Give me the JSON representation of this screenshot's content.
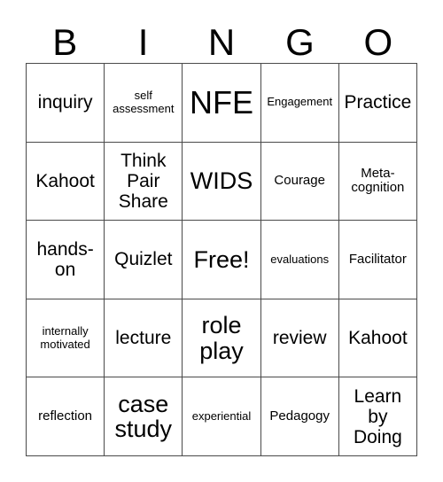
{
  "card": {
    "title": "BINGO",
    "header_letters": [
      "B",
      "I",
      "N",
      "G",
      "O"
    ],
    "free_space_label": "Free!",
    "grid_size": "5x5",
    "colors": {
      "background": "#ffffff",
      "text": "#000000",
      "grid_line": "#4a4a4a"
    },
    "rows": [
      [
        {
          "text": "inquiry",
          "size": "md"
        },
        {
          "text": "self\nassessment",
          "size": "xs"
        },
        {
          "text": "NFE",
          "size": "xl"
        },
        {
          "text": "Engagement",
          "size": "xs"
        },
        {
          "text": "Practice",
          "size": "md"
        }
      ],
      [
        {
          "text": "Kahoot",
          "size": "md"
        },
        {
          "text": "Think\nPair\nShare",
          "size": "md"
        },
        {
          "text": "WIDS",
          "size": "lg"
        },
        {
          "text": "Courage",
          "size": "sm"
        },
        {
          "text": "Meta-\ncognition",
          "size": "sm"
        }
      ],
      [
        {
          "text": "hands-\non",
          "size": "md"
        },
        {
          "text": "Quizlet",
          "size": "md"
        },
        {
          "text": "Free!",
          "size": "lg"
        },
        {
          "text": "evaluations",
          "size": "xs"
        },
        {
          "text": "Facilitator",
          "size": "sm"
        }
      ],
      [
        {
          "text": "internally\nmotivated",
          "size": "xs"
        },
        {
          "text": "lecture",
          "size": "md"
        },
        {
          "text": "role\nplay",
          "size": "lg"
        },
        {
          "text": "review",
          "size": "md"
        },
        {
          "text": "Kahoot",
          "size": "md"
        }
      ],
      [
        {
          "text": "reflection",
          "size": "sm"
        },
        {
          "text": "case\nstudy",
          "size": "lg"
        },
        {
          "text": "experiential",
          "size": "xs"
        },
        {
          "text": "Pedagogy",
          "size": "sm"
        },
        {
          "text": "Learn\nby\nDoing",
          "size": "md"
        }
      ]
    ]
  }
}
